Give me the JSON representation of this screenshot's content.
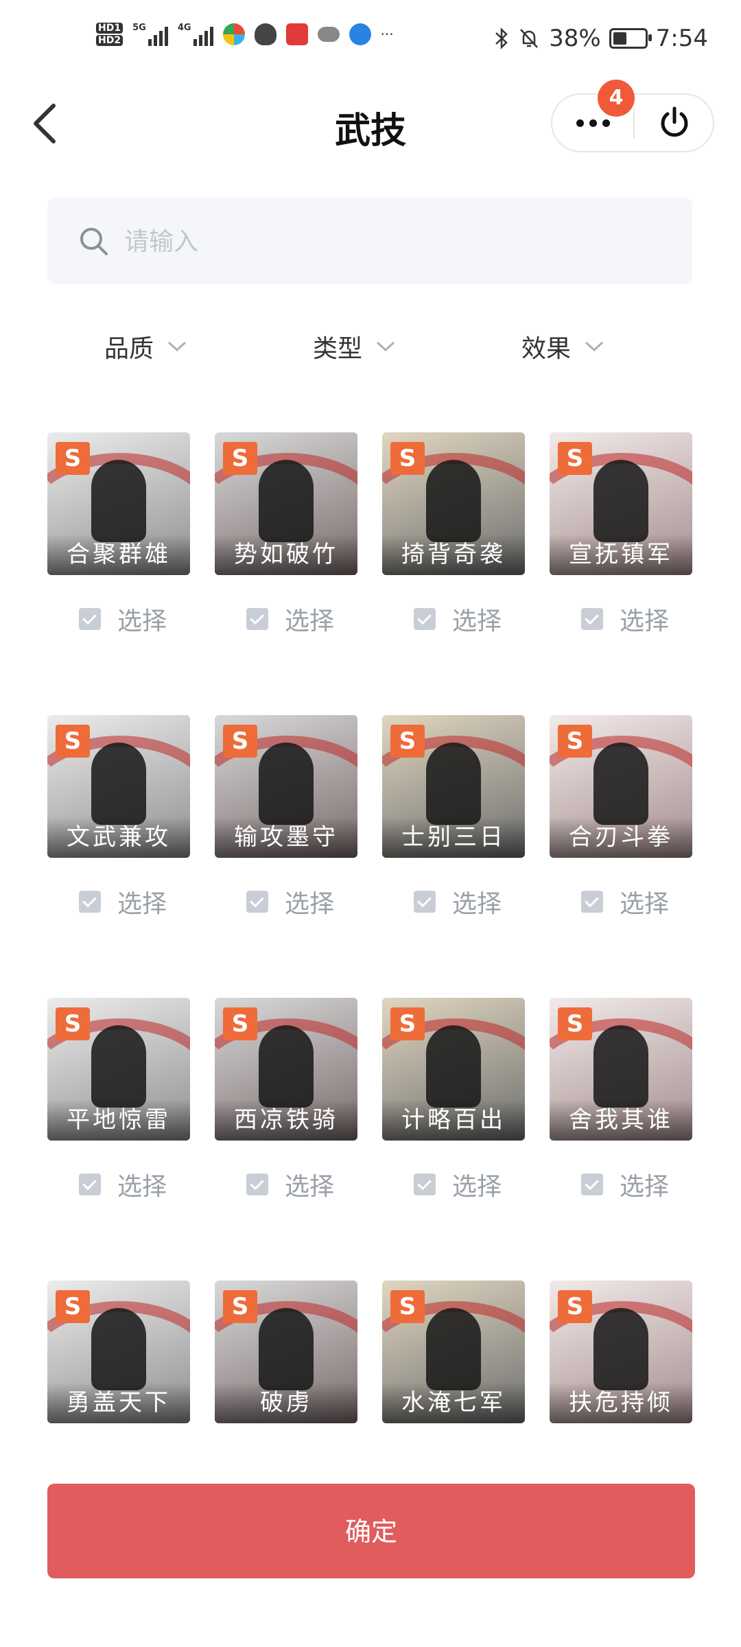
{
  "status_bar": {
    "hd1": "HD1",
    "hd2": "HD2",
    "sig1_label": "5G",
    "sig2_label": "4G",
    "more": "···",
    "battery_pct": "38%",
    "battery_level": 0.38,
    "time": "7:54"
  },
  "header": {
    "title": "武技",
    "badge_count": "4",
    "icons": {
      "back": "chevron-left-icon",
      "more": "more-dots-icon",
      "power": "power-icon"
    }
  },
  "search": {
    "placeholder": "请输入",
    "value": ""
  },
  "filters": [
    {
      "label": "品质"
    },
    {
      "label": "类型"
    },
    {
      "label": "效果"
    }
  ],
  "skills": [
    {
      "tier": "S",
      "name": "合聚群雄",
      "select_label": "选择"
    },
    {
      "tier": "S",
      "name": "势如破竹",
      "select_label": "选择"
    },
    {
      "tier": "S",
      "name": "掎背奇袭",
      "select_label": "选择"
    },
    {
      "tier": "S",
      "name": "宣抚镇军",
      "select_label": "选择"
    },
    {
      "tier": "S",
      "name": "文武兼攻",
      "select_label": "选择"
    },
    {
      "tier": "S",
      "name": "输攻墨守",
      "select_label": "选择"
    },
    {
      "tier": "S",
      "name": "士别三日",
      "select_label": "选择"
    },
    {
      "tier": "S",
      "name": "合刃斗拳",
      "select_label": "选择"
    },
    {
      "tier": "S",
      "name": "平地惊雷",
      "select_label": "选择"
    },
    {
      "tier": "S",
      "name": "西凉铁骑",
      "select_label": "选择"
    },
    {
      "tier": "S",
      "name": "计略百出",
      "select_label": "选择"
    },
    {
      "tier": "S",
      "name": "舍我其谁",
      "select_label": "选择"
    },
    {
      "tier": "S",
      "name": "勇盖天下",
      "select_label": "选择"
    },
    {
      "tier": "S",
      "name": "破虏",
      "select_label": "选择"
    },
    {
      "tier": "S",
      "name": "水淹七军",
      "select_label": "选择"
    },
    {
      "tier": "S",
      "name": "扶危持倾",
      "select_label": "选择"
    }
  ],
  "confirm_label": "确定",
  "colors": {
    "accent": "#e05c5d",
    "tier_badge": "#ee6c3a",
    "notification": "#f05a3a"
  }
}
